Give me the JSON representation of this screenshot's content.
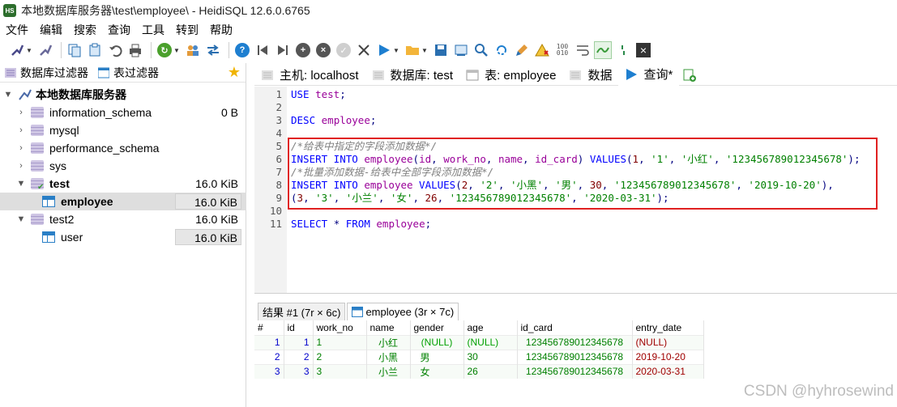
{
  "window": {
    "title": "本地数据库服务器\\test\\employee\\ - HeidiSQL 12.6.0.6765",
    "logo_text": "HS"
  },
  "menu": [
    "文件",
    "编辑",
    "搜索",
    "查询",
    "工具",
    "转到",
    "帮助"
  ],
  "filters": {
    "db_filter": "数据库过滤器",
    "table_filter": "表过滤器"
  },
  "tree": {
    "root": "本地数据库服务器",
    "items": [
      {
        "label": "information_schema",
        "size": "0 B"
      },
      {
        "label": "mysql",
        "size": ""
      },
      {
        "label": "performance_schema",
        "size": ""
      },
      {
        "label": "sys",
        "size": ""
      },
      {
        "label": "test",
        "size": "16.0 KiB"
      },
      {
        "label": "employee",
        "size": "16.0 KiB"
      },
      {
        "label": "test2",
        "size": "16.0 KiB"
      },
      {
        "label": "user",
        "size": "16.0 KiB"
      }
    ]
  },
  "tabs": {
    "host": "主机: localhost",
    "database": "数据库: test",
    "table": "表: employee",
    "data": "数据",
    "query": "查询*"
  },
  "editor": {
    "line_numbers": [
      "1",
      "2",
      "3",
      "4",
      "5",
      "6",
      "7",
      "8",
      "9",
      "10",
      "11"
    ]
  },
  "results": {
    "tab1": "结果 #1 (7r × 6c)",
    "tab2": "employee (3r × 7c)",
    "columns": [
      "#",
      "id",
      "work_no",
      "name",
      "gender",
      "age",
      "id_card",
      "entry_date"
    ],
    "rows": [
      [
        "1",
        "1",
        "1",
        "小红",
        "(NULL)",
        "(NULL)",
        "123456789012345678",
        "(NULL)"
      ],
      [
        "2",
        "2",
        "2",
        "小黑",
        "男",
        "30",
        "123456789012345678",
        "2019-10-20"
      ],
      [
        "3",
        "3",
        "3",
        "小兰",
        "女",
        "26",
        "123456789012345678",
        "2020-03-31"
      ]
    ]
  },
  "watermark": "CSDN @hyhrosewind",
  "colors": {
    "keyword": "#0000ff",
    "identifier": "#990099",
    "string": "#008000",
    "highlight_border": "#e02020"
  }
}
